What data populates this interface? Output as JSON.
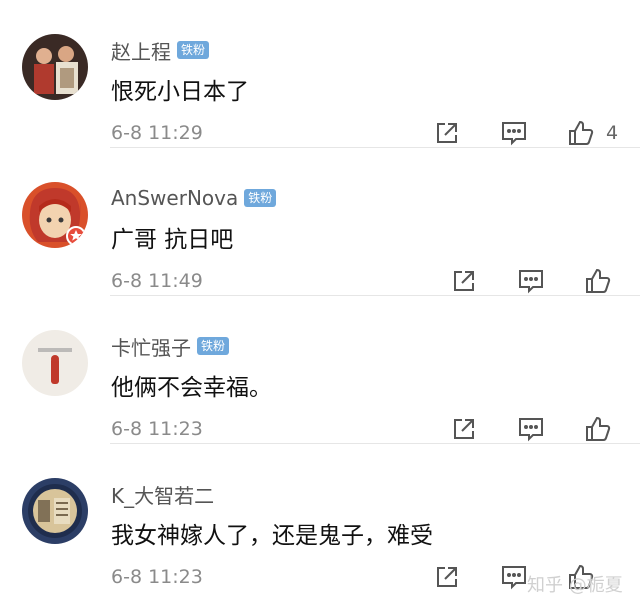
{
  "comments": [
    {
      "username": "赵上程",
      "badge": "铁粉",
      "text": "恨死小日本了",
      "time": "6-8 11:29",
      "likes": "4",
      "colors": {
        "bg": "#3a2a25",
        "accent": "#b03a2e"
      }
    },
    {
      "username": "AnSwerNova",
      "badge": "铁粉",
      "text": "广哥 抗日吧",
      "time": "6-8 11:49",
      "likes": "",
      "colors": {
        "bg": "#d9502a",
        "accent": "#f2d3b0"
      }
    },
    {
      "username": "卡忙强子",
      "badge": "铁粉",
      "text": "他俩不会幸福。",
      "time": "6-8 11:23",
      "likes": "",
      "colors": {
        "bg": "#f0ece6",
        "accent": "#c0392b"
      }
    },
    {
      "username": "K_大智若二",
      "badge": "",
      "text": "我女神嫁人了，还是鬼子，难受",
      "time": "6-8 11:23",
      "likes": "",
      "colors": {
        "bg": "#2c3e66",
        "accent": "#d8c49a"
      }
    }
  ],
  "actions": {
    "share_icon": "share-icon",
    "reply_icon": "comment-icon",
    "like_icon": "thumbs-up-icon"
  },
  "watermark": "知乎 @栀夏"
}
